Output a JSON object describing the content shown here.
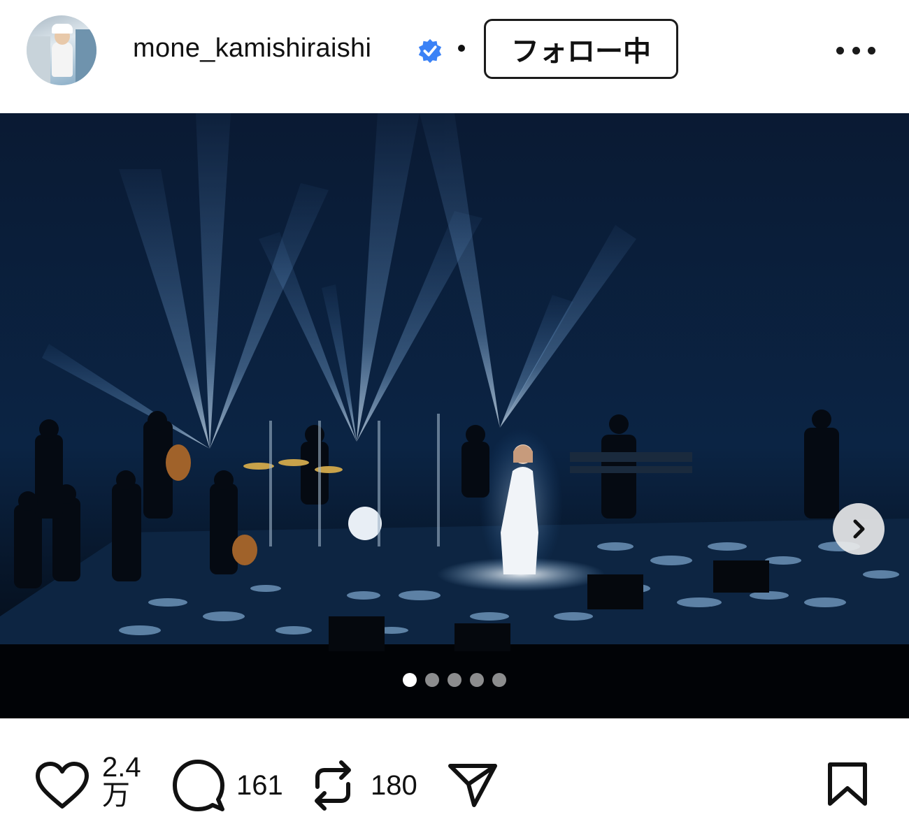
{
  "header": {
    "username": "mone_kamishiraishi",
    "verified_icon": "verified-badge-icon",
    "separator": "•",
    "follow_label": "フォロー中",
    "more_icon": "more-options-icon"
  },
  "post": {
    "image_alt": "Concert stage with orchestra and singer under blue spotlights",
    "carousel": {
      "total": 5,
      "current": 1
    },
    "next_icon": "chevron-right-icon"
  },
  "actions": {
    "like_icon": "heart-icon",
    "like_count": "2.4万",
    "comment_icon": "comment-icon",
    "comment_count": "161",
    "repost_icon": "repost-icon",
    "repost_count": "180",
    "share_icon": "send-icon",
    "save_icon": "bookmark-icon"
  },
  "colors": {
    "accent_verified": "#3b82f6",
    "text": "#111111",
    "stage_blue": "#2a6fb8"
  }
}
